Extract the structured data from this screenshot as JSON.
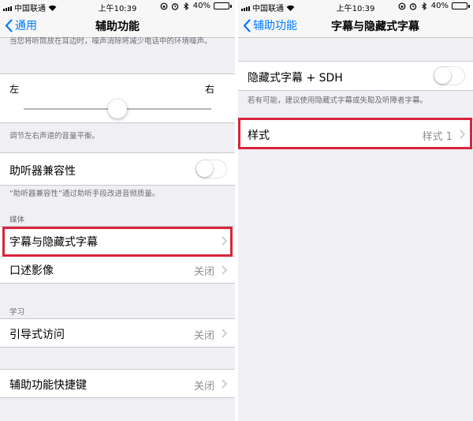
{
  "colors": {
    "accent": "#007aff",
    "highlight": "#d7253b",
    "background": "#efeff4"
  },
  "left": {
    "status": {
      "carrier": "中国联通",
      "time": "上午10:39",
      "battery": "40%",
      "battery_level": 0.4
    },
    "nav": {
      "back_label": "通用",
      "title": "辅助功能"
    },
    "top_note": "当您将听筒放在耳边时，噪声消除将减少电话中的环境噪声。",
    "balance": {
      "left_label": "左",
      "right_label": "右",
      "value": 0.5
    },
    "balance_note": "调节左右声道的音量平衡。",
    "hearing_aid": {
      "label": "助听器兼容性",
      "on": false
    },
    "hearing_aid_note": "“助听器兼容性”通过助听手段改进音频质量。",
    "media_header": "媒体",
    "subtitles": {
      "label": "字幕与隐藏式字幕"
    },
    "audio_description": {
      "label": "口述影像",
      "value": "关闭"
    },
    "learning_header": "学习",
    "guided_access": {
      "label": "引导式访问",
      "value": "关闭"
    },
    "shortcut": {
      "label": "辅助功能快捷键",
      "value": "关闭"
    }
  },
  "right": {
    "status": {
      "carrier": "中国联通",
      "time": "上午10:39",
      "battery": "40%",
      "battery_level": 0.4
    },
    "nav": {
      "back_label": "辅助功能",
      "title": "字幕与隐藏式字幕"
    },
    "cc_sdh": {
      "label": "隐藏式字幕 + SDH",
      "on": false
    },
    "cc_note": "若有可能，建议使用隐藏式字幕或失聪及听障者字幕。",
    "style": {
      "label": "样式",
      "value": "样式 1"
    }
  }
}
